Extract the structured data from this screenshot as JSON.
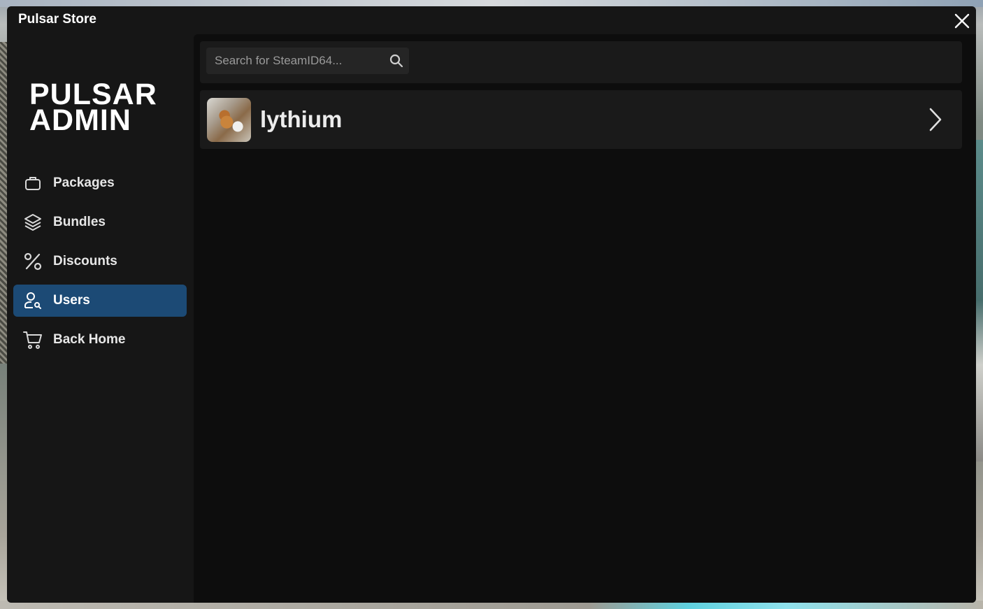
{
  "window": {
    "title": "Pulsar Store",
    "close_icon": "close-icon"
  },
  "sidebar": {
    "logo_line1": "PULSAR",
    "logo_line2": "ADMIN",
    "items": [
      {
        "label": "Packages",
        "icon": "briefcase-icon",
        "active": false
      },
      {
        "label": "Bundles",
        "icon": "layers-icon",
        "active": false
      },
      {
        "label": "Discounts",
        "icon": "percent-icon",
        "active": false
      },
      {
        "label": "Users",
        "icon": "user-search-icon",
        "active": true
      },
      {
        "label": "Back Home",
        "icon": "cart-icon",
        "active": false
      }
    ]
  },
  "main": {
    "search": {
      "placeholder": "Search for SteamID64...",
      "value": "",
      "icon": "search-icon"
    },
    "users": [
      {
        "name": "lythium",
        "avatar": "avatar",
        "action_icon": "chevron-right-icon"
      }
    ]
  },
  "colors": {
    "accent": "#1c4a75",
    "window_bg": "#161616",
    "content_bg": "#0d0d0d",
    "row_bg": "#1a1a1a"
  }
}
